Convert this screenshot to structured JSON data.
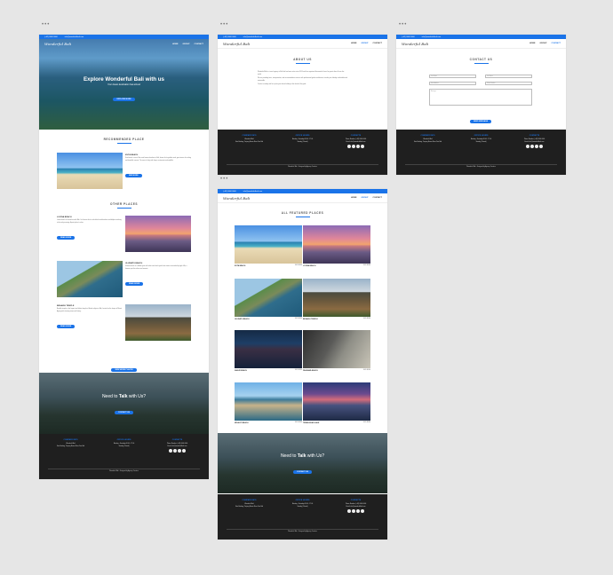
{
  "markers": "•••",
  "topbar": {
    "phone": "(+62) 0000 0000",
    "email": "info@wonderfulbali.com"
  },
  "brand": {
    "logo": "Wonderful Bali"
  },
  "menu": [
    "HOME",
    "GROUP",
    "CONTACT"
  ],
  "home": {
    "hero_title": "Explore Wonderful Bali with us",
    "hero_sub": "Your dream destination has arrived",
    "hero_button": "EXPLORE MORE",
    "recommended_title": "RECOMMENDED PLACE",
    "kuta_name": "KUTA BEACH",
    "kuta_text": "Kuta beach is one of the most famous beaches in Bali, known for its golden sand, great waves for surfing and beautiful sunsets. The area is lively with shops, restaurants and nightlife.",
    "kuta_button": "SEE MORE",
    "other_title": "OTHER PLACES",
    "lovina_name": "LOVINA BEACH",
    "lovina_text": "Lovina beach is located in north Bali. It is famous for its calm black sand beaches and dolphin watching in the early morning. A quiet place to relax.",
    "lovina_button": "READ MORE",
    "uluwatu_name": "ULUWATU BEACH",
    "uluwatu_text": "Uluwatu beach is a hidden gem with white sand and crystal clear water surrounded by high cliffs, a famous spot for surfers and sunsets.",
    "uluwatu_button": "READ MORE",
    "besakih_name": "BESAKIH TEMPLE",
    "besakih_text": "Besakih temple is the largest and holiest temple of Hindu religion in Bali, located on the slopes of Mount Agung with stunning views and history.",
    "besakih_button": "READ MORE",
    "view_more": "VIEW MORE PLACES",
    "talk_title_a": "Need to ",
    "talk_title_b": "Talk",
    "talk_title_c": " with Us?",
    "talk_button": "CONTACT US"
  },
  "about": {
    "title": "ABOUT US",
    "p1": "Wonderful Bali is a travel agency in Bali that has been active since 2010 and has organized thousands of tours for guests from all over the world.",
    "p2": "We are providing tours, transportation, and accommodation services with professional guides and drivers to make your holiday comfortable and memorable.",
    "p3": "Contact us today and let us plan your dream holiday to the island of the gods."
  },
  "contact": {
    "title": "CONTACT US",
    "first_name": "First Name",
    "last_name": "Last Name",
    "email": "Email Address",
    "phone": "Phone Number",
    "message": "Message",
    "send": "SEND MESSAGE"
  },
  "featured": {
    "title": "ALL FEATURED PLACES",
    "view": "VIEW MORE",
    "places": [
      "KUTA BEACH",
      "LOVINA BEACH",
      "ULUWATU BEACH",
      "BESAKIH TEMPLE",
      "SANUR BEACH",
      "PANDAWA BEACH",
      "MELASTI BEACH",
      "TEMBLINGAN LAKE"
    ]
  },
  "footer": {
    "company": "COMPANY INFO",
    "company_lines": [
      "Wonderful Bali",
      "Kuta Badung, Tanjung Benoa Nusa Dua Bali"
    ],
    "office": "OFFICE HOURS",
    "office_lines": [
      "Monday - Saturday 08.00 - 17.00",
      "Sunday (Closed)"
    ],
    "contact": "CONTACTS",
    "contact_lines": [
      "Phone Number: (+62) 0000 0000",
      "Email: info@wonderfulbali.com"
    ],
    "copyright": "Wonderful Bali - Designed by Agency Creative"
  }
}
